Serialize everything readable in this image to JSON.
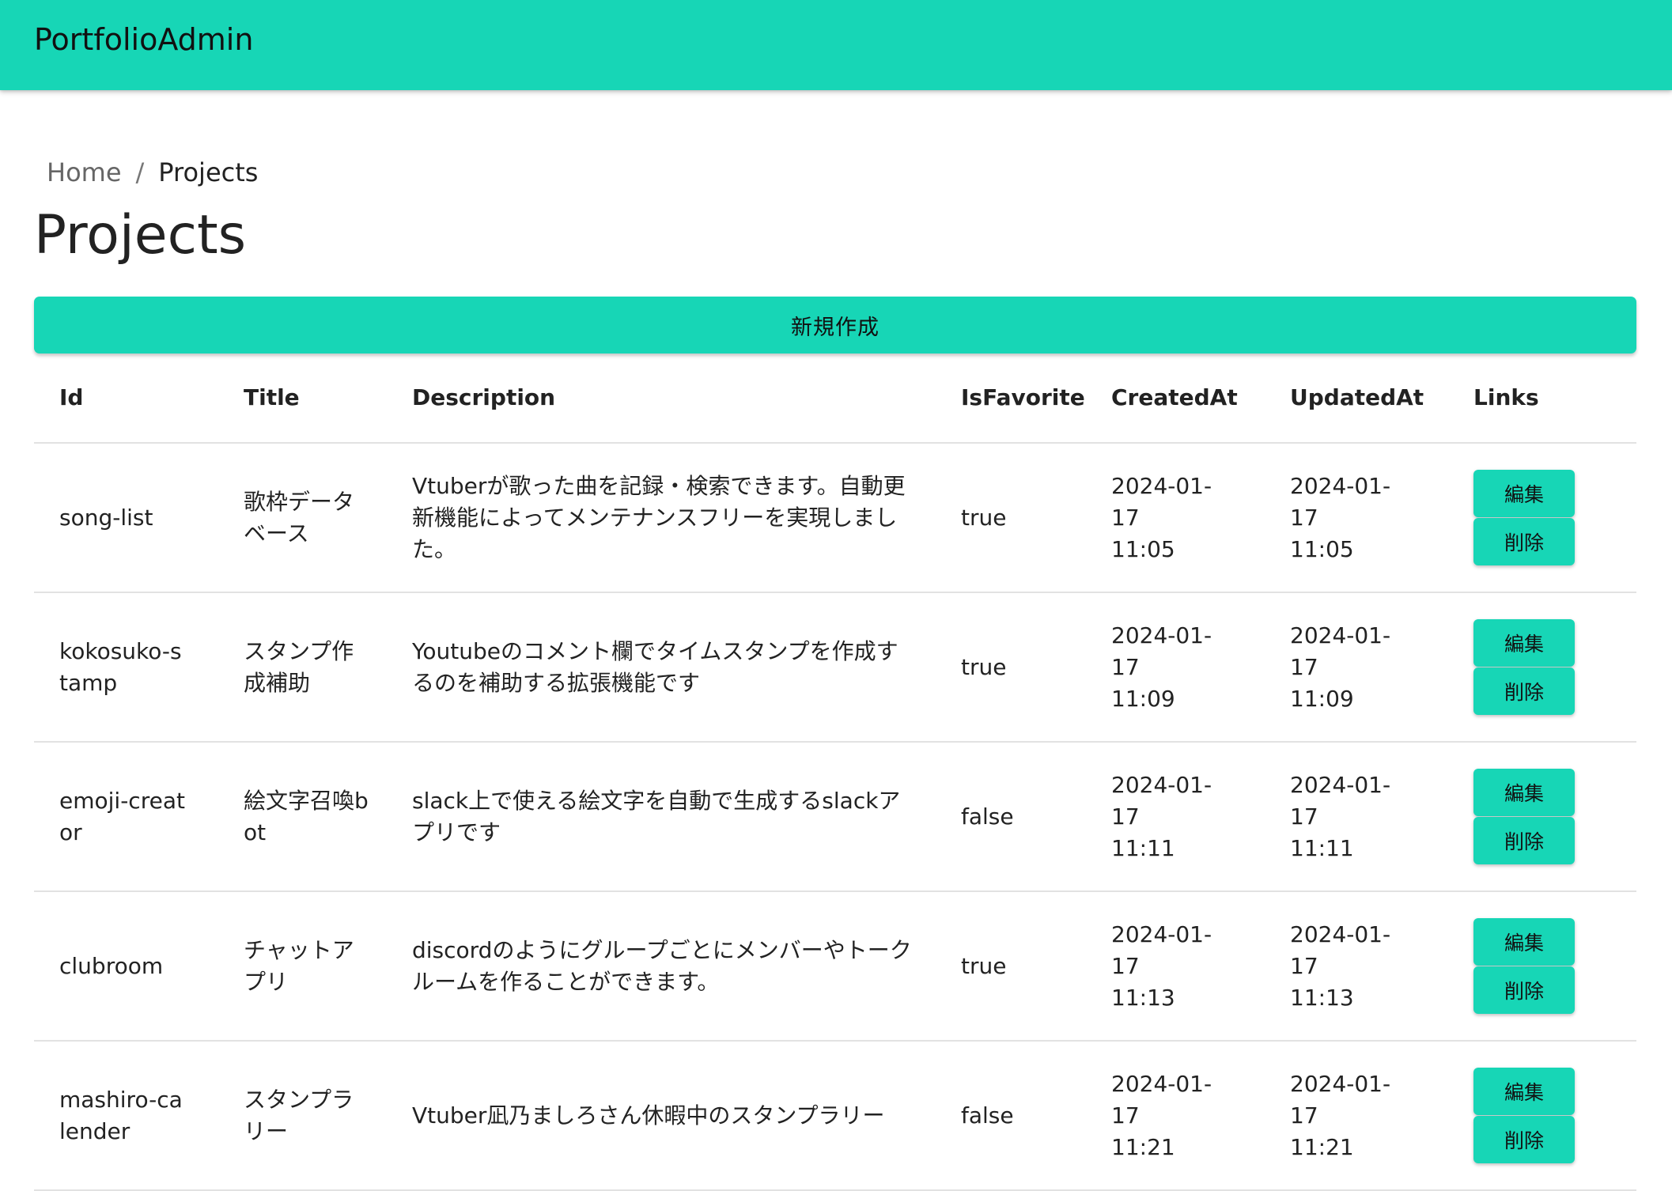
{
  "app": {
    "title": "PortfolioAdmin"
  },
  "breadcrumb": {
    "home": "Home",
    "separator": "/",
    "current": "Projects"
  },
  "page": {
    "title": "Projects"
  },
  "actions": {
    "create_label": "新規作成"
  },
  "colors": {
    "accent": "#17d6b6",
    "divider": "#e2e2e2",
    "text": "#222222"
  },
  "table": {
    "headers": {
      "id": "Id",
      "title": "Title",
      "description": "Description",
      "is_favorite": "IsFavorite",
      "created_at": "CreatedAt",
      "updated_at": "UpdatedAt",
      "links": "Links"
    },
    "edit_label": "編集",
    "delete_label": "削除",
    "rows": [
      {
        "id": "song-list",
        "title": "歌枠データベース",
        "description": "Vtuberが歌った曲を記録・検索できます。自動更新機能によってメンテナンスフリーを実現しました。",
        "is_favorite": "true",
        "created_date": "2024-01-17",
        "created_time": "11:05",
        "updated_date": "2024-01-17",
        "updated_time": "11:05"
      },
      {
        "id": "kokosuko-stamp",
        "title": "スタンプ作成補助",
        "description": "Youtubeのコメント欄でタイムスタンプを作成するのを補助する拡張機能です",
        "is_favorite": "true",
        "created_date": "2024-01-17",
        "created_time": "11:09",
        "updated_date": "2024-01-17",
        "updated_time": "11:09"
      },
      {
        "id": "emoji-creator",
        "title": "絵文字召喚bot",
        "description": "slack上で使える絵文字を自動で生成するslackアプリです",
        "is_favorite": "false",
        "created_date": "2024-01-17",
        "created_time": "11:11",
        "updated_date": "2024-01-17",
        "updated_time": "11:11"
      },
      {
        "id": "clubroom",
        "title": "チャットアプリ",
        "description": "discordのようにグループごとにメンバーやトークルームを作ることができます。",
        "is_favorite": "true",
        "created_date": "2024-01-17",
        "created_time": "11:13",
        "updated_date": "2024-01-17",
        "updated_time": "11:13"
      },
      {
        "id": "mashiro-calender",
        "title": "スタンプラリー",
        "description": "Vtuber凪乃ましろさん休暇中のスタンプラリー",
        "is_favorite": "false",
        "created_date": "2024-01-17",
        "created_time": "11:21",
        "updated_date": "2024-01-17",
        "updated_time": "11:21"
      }
    ]
  }
}
